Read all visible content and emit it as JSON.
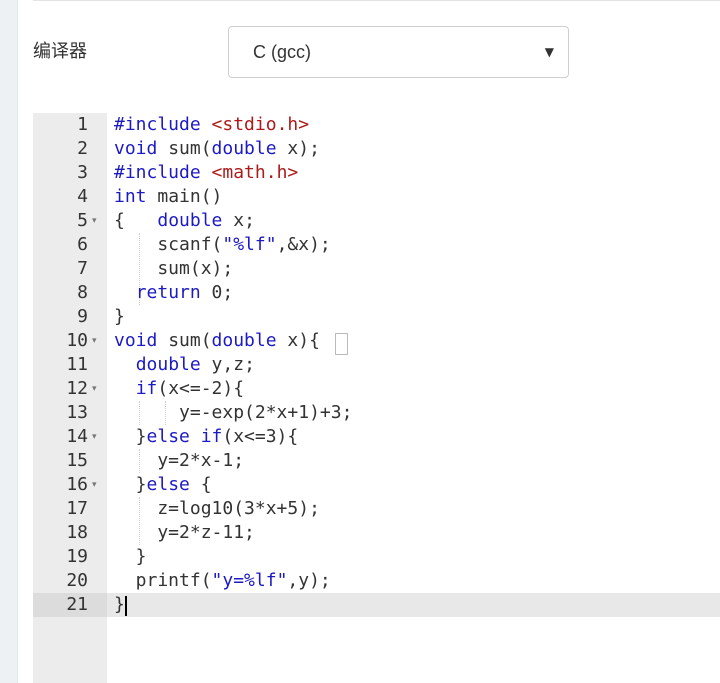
{
  "form": {
    "compiler_label": "编译器",
    "compiler_value": "C (gcc)",
    "dropdown_arrow": "▼"
  },
  "editor": {
    "fold_marker": "▾",
    "active_line": 21,
    "lines": [
      {
        "number": "1",
        "fold": false,
        "tokens": [
          {
            "t": "#include ",
            "c": "keyword"
          },
          {
            "t": "<stdio.h>",
            "c": "string"
          }
        ]
      },
      {
        "number": "2",
        "fold": false,
        "tokens": [
          {
            "t": "void",
            "c": "keyword"
          },
          {
            "t": " sum(",
            "c": "plain"
          },
          {
            "t": "double",
            "c": "keyword"
          },
          {
            "t": " x);",
            "c": "plain"
          }
        ]
      },
      {
        "number": "3",
        "fold": false,
        "tokens": [
          {
            "t": "#include ",
            "c": "keyword"
          },
          {
            "t": "<math.h>",
            "c": "string"
          }
        ]
      },
      {
        "number": "4",
        "fold": false,
        "tokens": [
          {
            "t": "int",
            "c": "keyword"
          },
          {
            "t": " main()",
            "c": "plain"
          }
        ]
      },
      {
        "number": "5",
        "fold": true,
        "tokens": [
          {
            "t": "{   ",
            "c": "plain"
          },
          {
            "t": "double",
            "c": "keyword"
          },
          {
            "t": " x;",
            "c": "plain"
          }
        ]
      },
      {
        "number": "6",
        "fold": false,
        "tokens": [
          {
            "t": "    scanf(",
            "c": "plain"
          },
          {
            "t": "\"%lf\"",
            "c": "keyword"
          },
          {
            "t": ",&x);",
            "c": "plain"
          }
        ]
      },
      {
        "number": "7",
        "fold": false,
        "tokens": [
          {
            "t": "    sum(x);",
            "c": "plain"
          }
        ]
      },
      {
        "number": "8",
        "fold": false,
        "tokens": [
          {
            "t": "  ",
            "c": "plain"
          },
          {
            "t": "return",
            "c": "keyword"
          },
          {
            "t": " 0;",
            "c": "plain"
          }
        ]
      },
      {
        "number": "9",
        "fold": false,
        "tokens": [
          {
            "t": "}",
            "c": "plain"
          }
        ]
      },
      {
        "number": "10",
        "fold": true,
        "tokens": [
          {
            "t": "void",
            "c": "keyword"
          },
          {
            "t": " sum(",
            "c": "plain"
          },
          {
            "t": "double",
            "c": "keyword"
          },
          {
            "t": " x){",
            "c": "plain"
          }
        ]
      },
      {
        "number": "11",
        "fold": false,
        "tokens": [
          {
            "t": "  ",
            "c": "plain"
          },
          {
            "t": "double",
            "c": "keyword"
          },
          {
            "t": " y,z;",
            "c": "plain"
          }
        ]
      },
      {
        "number": "12",
        "fold": true,
        "tokens": [
          {
            "t": "  ",
            "c": "plain"
          },
          {
            "t": "if",
            "c": "keyword"
          },
          {
            "t": "(x<=-2){",
            "c": "plain"
          }
        ]
      },
      {
        "number": "13",
        "fold": false,
        "tokens": [
          {
            "t": "      y=-exp(2*x+1)+3;",
            "c": "plain"
          }
        ]
      },
      {
        "number": "14",
        "fold": true,
        "tokens": [
          {
            "t": "  }",
            "c": "plain"
          },
          {
            "t": "else if",
            "c": "keyword"
          },
          {
            "t": "(x<=3){",
            "c": "plain"
          }
        ]
      },
      {
        "number": "15",
        "fold": false,
        "tokens": [
          {
            "t": "    y=2*x-1;",
            "c": "plain"
          }
        ]
      },
      {
        "number": "16",
        "fold": true,
        "tokens": [
          {
            "t": "  }",
            "c": "plain"
          },
          {
            "t": "else",
            "c": "keyword"
          },
          {
            "t": " {",
            "c": "plain"
          }
        ]
      },
      {
        "number": "17",
        "fold": false,
        "tokens": [
          {
            "t": "    z=log10(3*x+5);",
            "c": "plain"
          }
        ]
      },
      {
        "number": "18",
        "fold": false,
        "tokens": [
          {
            "t": "    y=2*z-11;",
            "c": "plain"
          }
        ]
      },
      {
        "number": "19",
        "fold": false,
        "tokens": [
          {
            "t": "  }",
            "c": "plain"
          }
        ]
      },
      {
        "number": "20",
        "fold": false,
        "tokens": [
          {
            "t": "  printf(",
            "c": "plain"
          },
          {
            "t": "\"y=%lf\"",
            "c": "keyword"
          },
          {
            "t": ",y);",
            "c": "plain"
          }
        ]
      },
      {
        "number": "21",
        "fold": false,
        "tokens": [
          {
            "t": "}",
            "c": "plain"
          }
        ]
      }
    ]
  }
}
